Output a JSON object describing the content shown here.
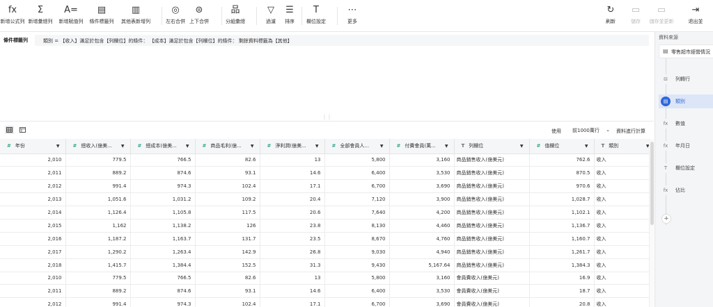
{
  "toolbar": {
    "left_buttons": [
      {
        "icon": "fx-icon",
        "glyph": "fx",
        "label": "新增公式列"
      },
      {
        "icon": "sum-icon",
        "glyph": "Σ",
        "label": "新增彙總列"
      },
      {
        "icon": "assign-icon",
        "glyph": "A=",
        "label": "新增賦值列"
      },
      {
        "icon": "condition-tag-icon",
        "glyph": "▤",
        "label": "條件標籤列"
      },
      {
        "icon": "other-table-icon",
        "glyph": "▥",
        "label": "其他表新增列"
      },
      {
        "icon": "merge-lr-icon",
        "glyph": "◎",
        "label": "左右合併"
      },
      {
        "icon": "merge-ud-icon",
        "glyph": "⊜",
        "label": "上下合併"
      },
      {
        "icon": "group-summary-icon",
        "glyph": "品",
        "label": "分組彙總"
      },
      {
        "icon": "filter-icon",
        "glyph": "▽",
        "label": "過濾"
      },
      {
        "icon": "sort-icon",
        "glyph": "☰",
        "label": "排序"
      },
      {
        "icon": "field-settings-icon",
        "glyph": "T",
        "label": "欄位設定"
      },
      {
        "icon": "more-icon",
        "glyph": "⋯",
        "label": "更多"
      }
    ],
    "right_buttons": [
      {
        "icon": "refresh-icon",
        "glyph": "↻",
        "label": "刷新",
        "disabled": false
      },
      {
        "icon": "save-icon",
        "glyph": "▭",
        "label": "儲存",
        "disabled": true
      },
      {
        "icon": "save-update-icon",
        "glyph": "▭",
        "label": "儲存並更新",
        "disabled": true
      },
      {
        "icon": "exit-icon",
        "glyph": "⇥",
        "label": "退出並",
        "disabled": false
      }
    ]
  },
  "condition": {
    "title": "條件標籤列",
    "text": "類別 = 【收入】滿足於包含【列欄位】的條件：  【成本】滿足於包含【列欄位】的條件：   剩餘資料標籤為【其他】"
  },
  "grid_bar": {
    "use_label": "使用",
    "rows_option": "前1000萬行",
    "calc_label": "資料進行計算"
  },
  "columns": [
    {
      "type": "#",
      "name": "年份"
    },
    {
      "type": "#",
      "name": "總收入(億美..."
    },
    {
      "type": "#",
      "name": "總成本(億美..."
    },
    {
      "type": "#",
      "name": "商品毛利(億..."
    },
    {
      "type": "#",
      "name": "淨利潤(億美..."
    },
    {
      "type": "#",
      "name": "全部會員人..."
    },
    {
      "type": "#",
      "name": "付費會員(萬..."
    },
    {
      "type": "T",
      "name": "列欄位"
    },
    {
      "type": "#",
      "name": "值欄位"
    },
    {
      "type": "T",
      "name": "類別"
    }
  ],
  "rows": [
    [
      "2,010",
      "779.5",
      "766.5",
      "82.6",
      "13",
      "5,800",
      "3,160",
      "商品銷售收入(億美元)",
      "762.6",
      "收入"
    ],
    [
      "2,011",
      "889.2",
      "874.6",
      "93.1",
      "14.6",
      "6,400",
      "3,530",
      "商品銷售收入(億美元)",
      "870.5",
      "收入"
    ],
    [
      "2,012",
      "991.4",
      "974.3",
      "102.4",
      "17.1",
      "6,700",
      "3,690",
      "商品銷售收入(億美元)",
      "970.6",
      "收入"
    ],
    [
      "2,013",
      "1,051.6",
      "1,031.2",
      "109.2",
      "20.4",
      "7,120",
      "3,900",
      "商品銷售收入(億美元)",
      "1,028.7",
      "收入"
    ],
    [
      "2,014",
      "1,126.4",
      "1,105.8",
      "117.5",
      "20.6",
      "7,640",
      "4,200",
      "商品銷售收入(億美元)",
      "1,102.1",
      "收入"
    ],
    [
      "2,015",
      "1,162",
      "1,138.2",
      "126",
      "23.8",
      "8,130",
      "4,460",
      "商品銷售收入(億美元)",
      "1,136.7",
      "收入"
    ],
    [
      "2,016",
      "1,187.2",
      "1,163.7",
      "131.7",
      "23.5",
      "8,670",
      "4,760",
      "商品銷售收入(億美元)",
      "1,160.7",
      "收入"
    ],
    [
      "2,017",
      "1,290.2",
      "1,263.4",
      "142.9",
      "26.8",
      "9,030",
      "4,940",
      "商品銷售收入(億美元)",
      "1,261.7",
      "收入"
    ],
    [
      "2,018",
      "1,415.7",
      "1,384.4",
      "152.5",
      "31.3",
      "9,430",
      "5,167.64",
      "商品銷售收入(億美元)",
      "1,384.3",
      "收入"
    ],
    [
      "2,010",
      "779.5",
      "766.5",
      "82.6",
      "13",
      "5,800",
      "3,160",
      "會員費收入(億美元)",
      "16.9",
      "收入"
    ],
    [
      "2,011",
      "889.2",
      "874.6",
      "93.1",
      "14.6",
      "6,400",
      "3,530",
      "會員費收入(億美元)",
      "18.7",
      "收入"
    ],
    [
      "2,012",
      "991.4",
      "974.3",
      "102.4",
      "17.1",
      "6,700",
      "3,690",
      "會員費收入(億美元)",
      "20.8",
      "收入"
    ]
  ],
  "right_panel": {
    "title": "資料來源",
    "source": "零售超市經營情況",
    "steps": [
      {
        "icon": "row-to-col-icon",
        "glyph": "⊟",
        "label": "列轉行",
        "active": false
      },
      {
        "icon": "category-icon",
        "glyph": "▤",
        "label": "類別",
        "active": true
      },
      {
        "icon": "fx-icon",
        "glyph": "fx",
        "label": "數值",
        "active": false
      },
      {
        "icon": "fx-icon",
        "glyph": "fx",
        "label": "年月日",
        "active": false
      },
      {
        "icon": "field-settings-icon",
        "glyph": "T",
        "label": "欄位設定",
        "active": false
      },
      {
        "icon": "fx-icon",
        "glyph": "fx",
        "label": "佔比",
        "active": false
      }
    ],
    "add_glyph": "+"
  },
  "colors": {
    "accent": "#2f67d8",
    "number_type": "#3aa88e",
    "header_bg": "#f5f6f8"
  }
}
